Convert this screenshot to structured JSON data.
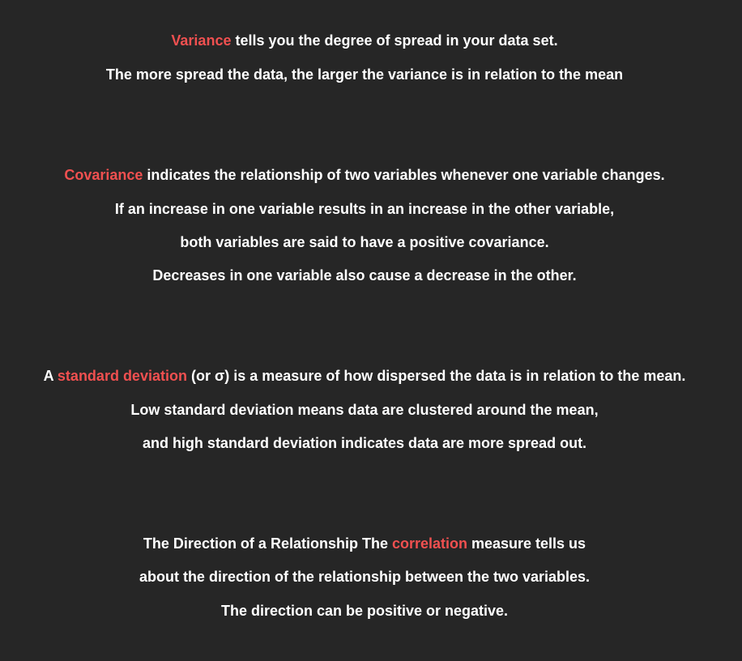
{
  "variance": {
    "line1_term": "Variance",
    "line1_rest": " tells you the degree of spread in your data set.",
    "line2": "The more spread the data, the larger the variance is in relation to the mean"
  },
  "covariance": {
    "line1_term": "Covariance",
    "line1_rest": " indicates the relationship of two variables whenever one variable changes.",
    "line2": "If an increase in one variable results in an increase in the other variable,",
    "line3": "both variables are said to have a positive covariance.",
    "line4": "Decreases in one variable also cause a decrease in the other."
  },
  "std_dev": {
    "line1_pre": "A ",
    "line1_term": "standard deviation",
    "line1_rest": " (or σ) is a measure of how dispersed the data is in relation to the mean.",
    "line2": "Low standard deviation means data are clustered around the mean,",
    "line3": "and high standard deviation indicates data are more spread out."
  },
  "correlation": {
    "line1_pre": "The Direction of a Relationship The ",
    "line1_term": "correlation",
    "line1_rest": " measure tells us",
    "line2": "about the direction of the relationship between the two variables.",
    "line3": "The direction can be positive or negative."
  },
  "colors": {
    "background": "#262626",
    "text": "#ffffff",
    "highlight": "#f05050"
  }
}
